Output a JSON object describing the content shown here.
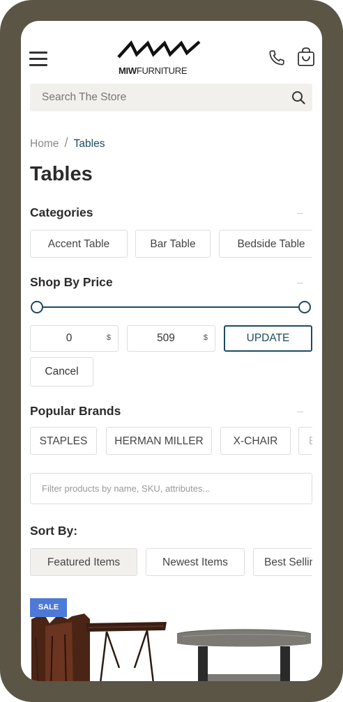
{
  "header": {
    "logo_brand": "MIW",
    "logo_suffix": "FURNITURE"
  },
  "search": {
    "placeholder": "Search The Store"
  },
  "breadcrumb": {
    "home": "Home",
    "separator": "/",
    "current": "Tables"
  },
  "page_title": "Tables",
  "categories": {
    "title": "Categories",
    "items": [
      "Accent Table",
      "Bar Table",
      "Bedside Table"
    ]
  },
  "price": {
    "title": "Shop By Price",
    "min": "0",
    "max": "509",
    "currency": "$",
    "range_fraction": [
      0,
      1
    ],
    "update_label": "UPDATE",
    "cancel_label": "Cancel"
  },
  "brands": {
    "title": "Popular Brands",
    "items": [
      "STAPLES",
      "HERMAN MILLER",
      "X-CHAIR",
      "B"
    ]
  },
  "filter": {
    "placeholder": "Filter products by name, SKU, attributes..."
  },
  "sort": {
    "title": "Sort By:",
    "items": [
      "Featured Items",
      "Newest Items",
      "Best Selling"
    ],
    "selected": "Featured Items"
  },
  "product": {
    "badge": "SALE"
  },
  "colors": {
    "accent": "#1d4a5e",
    "frame": "#5a5545",
    "sale_badge": "#4d7ad8"
  }
}
